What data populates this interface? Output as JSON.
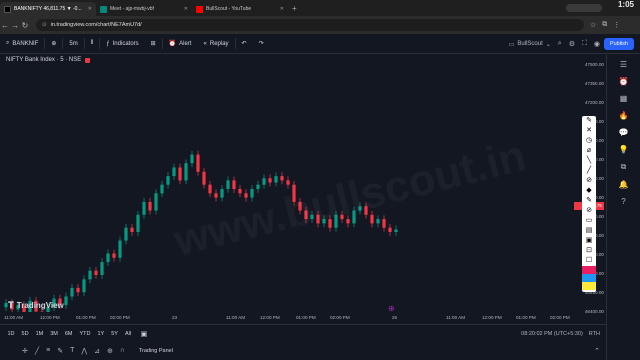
{
  "browser": {
    "tabs": [
      {
        "label": "BANKNIFTY 46,811.75 ▼ -0...",
        "color": "#131722",
        "active": true
      },
      {
        "label": "Meet - ajp-mwbj-vbf",
        "color": "#00897b",
        "active": false
      },
      {
        "label": "BullScout - YouTube",
        "color": "#ff0000",
        "active": false
      }
    ],
    "url": "in.tradingview.com/chart/NE7AmU7d/",
    "clock": "1:05"
  },
  "toolbar": {
    "symbol": "BANKNIF",
    "interval": "5m",
    "indicators": "Indicators",
    "alert": "Alert",
    "replay": "Replay",
    "layout": "BullScout",
    "publish": "Publish"
  },
  "chart": {
    "legend": "NIFTY Bank Index · 5 · NSE",
    "watermark": "www.bullscout.in",
    "logo": "TradingView",
    "price_tag": "46811.75",
    "price_labels": [
      "47500.00",
      "47350.00",
      "47200.00",
      "47050.00",
      "46900.00",
      "46850.00",
      "46750.00",
      "46700.00",
      "46650.00",
      "46600.00",
      "46550.00",
      "46500.00",
      "46450.00",
      "46400.00"
    ],
    "time_labels": [
      "11:00 AM",
      "12:00 PM",
      "01:00 PM",
      "02:00 PM",
      "23",
      "11:00 AM",
      "12:00 PM",
      "01:00 PM",
      "02:00 PM",
      "26",
      "11:00 AM",
      "12:00 PM",
      "01:00 PM",
      "02:00 PM"
    ]
  },
  "chart_data": {
    "type": "candlestick",
    "title": "NIFTY Bank Index · 5 · NSE",
    "series": [
      {
        "name": "BANKNIFTY",
        "values": [
          46470,
          46440,
          46460,
          46420,
          46480,
          46430,
          46400,
          46450,
          46490,
          46460,
          46500,
          46540,
          46520,
          46580,
          46620,
          46600,
          46660,
          46700,
          46680,
          46760,
          46820,
          46800,
          46880,
          46940,
          46900,
          46980,
          47020,
          47060,
          47100,
          47040,
          47120,
          47160,
          47080,
          47020,
          46980,
          46960,
          47000,
          47040,
          47000,
          46980,
          46960,
          47000,
          47020,
          47050,
          47030,
          47060,
          47040,
          47020,
          46940,
          46900,
          46860,
          46880,
          46840,
          46860,
          46820,
          46880,
          46860,
          46840,
          46900,
          46920,
          46880,
          46840,
          46860,
          46820,
          46800,
          46811.75
        ]
      }
    ],
    "ylim": [
      46400,
      47600
    ]
  },
  "bottom": {
    "ranges": [
      "1D",
      "5D",
      "1M",
      "3M",
      "6M",
      "YTD",
      "1Y",
      "5Y",
      "All"
    ],
    "time": "08:20:02 PM (UTC+5:30)",
    "rth": "RTH",
    "panel": "Trading Panel"
  }
}
